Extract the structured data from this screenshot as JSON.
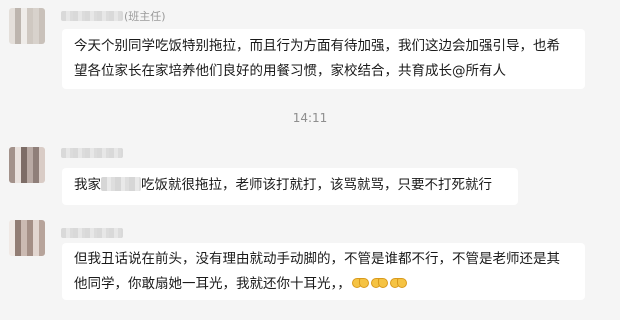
{
  "messages": [
    {
      "sender_suffix": "(班主任)",
      "lines": [
        "今天个别同学吃饭特别拖拉，而且行为方面有待加强，我们这边会加强引导，也希",
        "望各位家长在家培养他们良好的用餐习惯，家校结合，共育成长@所有人"
      ]
    },
    {
      "line_prefix": "我家",
      "line_suffix": "吃饭就很拖拉，老师该打就打，该骂就骂，只要不打死就行"
    },
    {
      "lines": [
        "但我丑话说在前头，没有理由就动手动脚的，不管是谁都不行，不管是老师还是其",
        "他同学，你敢扇她一耳光，我就还你十耳光，，"
      ],
      "emoji": [
        "folded-hands-icon",
        "folded-hands-icon",
        "folded-hands-icon"
      ]
    }
  ],
  "timestamp": "14:11",
  "colors": {
    "background": "#f5f5f5",
    "bubble": "#ffffff",
    "text": "#1a1a1a",
    "meta": "#8e8e8e"
  }
}
